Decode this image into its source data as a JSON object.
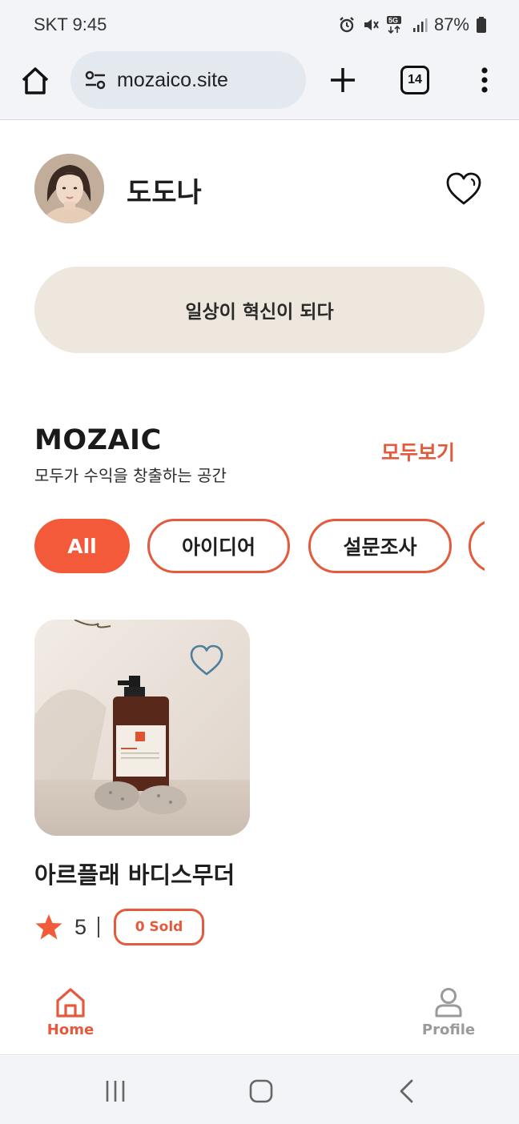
{
  "status_bar": {
    "time": "SKT 9:45",
    "battery": "87%",
    "network": "5G"
  },
  "browser": {
    "url": "mozaico.site",
    "tab_count": "14"
  },
  "profile": {
    "name": "도도나"
  },
  "slogan": "일상이 혁신이 되다",
  "section": {
    "title": "MOZAIC",
    "subtitle": "모두가 수익을 창출하는 공간",
    "see_all": "모두보기"
  },
  "filters": [
    {
      "label": "All",
      "active": true
    },
    {
      "label": "아이디어",
      "active": false
    },
    {
      "label": "설문조사",
      "active": false
    },
    {
      "label": "",
      "active": false
    }
  ],
  "product": {
    "title": "아르플래 바디스무더",
    "rating": "5",
    "sold": "0 Sold"
  },
  "nav": {
    "home": "Home",
    "profile": "Profile"
  },
  "colors": {
    "accent": "#e35a3c",
    "chip_active": "#f25a3a",
    "banner_bg": "#ede7dd",
    "heart_blue": "#4f7f9c"
  }
}
